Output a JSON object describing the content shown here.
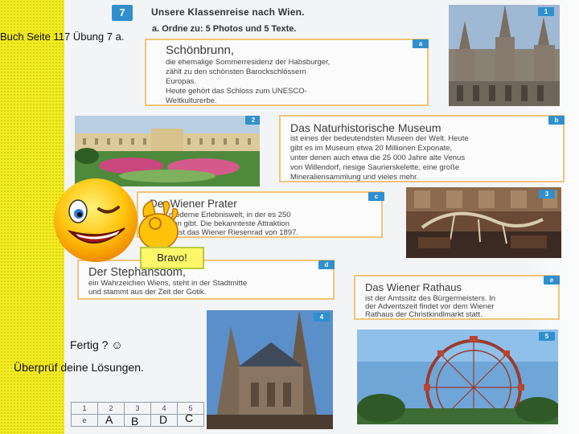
{
  "task_label": "Buch Seite 117 Übung 7 a.",
  "book": {
    "exercise_number": "7",
    "heading": "Unsere Klassenreise nach Wien.",
    "instruction": "a. Ordne zu: 5 Photos und 5 Texte."
  },
  "texts": [
    {
      "tag": "a",
      "title": "Schönbrunn,",
      "lines": [
        "die ehemalige Sommerresidenz der Habsburger,",
        "zählt zu den schönsten Barockschlössern",
        "Europas.",
        "Heute gehört das Schloss zum UNESCO-",
        "Weltkulturerbe."
      ]
    },
    {
      "tag": "b",
      "title": "Das Naturhistorische Museum",
      "lines": [
        "ist eines der bedeutendsten Museen der Welt. Heute",
        "gibt es im Museum etwa 20 Millionen Exponate,",
        "unter denen auch etwa die 25 000 Jahre alte Venus",
        "von Willendorf, riesige Saurierskelette, eine große",
        "Mineraliensammlung und vieles mehr."
      ]
    },
    {
      "tag": "c",
      "title": "Der Wiener Prater",
      "lines": [
        "moderne Erlebniswelt, in der es 250",
        "nen gibt. Die bekannteste Attraktion",
        "rs ist das Wiener Riesenrad von 1897."
      ]
    },
    {
      "tag": "d",
      "title": "Der Stephansdom,",
      "lines": [
        "ein Wahrzeichen Wiens, steht in der Stadtmitte",
        "und stammt aus der Zeit der Gotik."
      ]
    },
    {
      "tag": "e",
      "title": "Das Wiener Rathaus",
      "lines": [
        "ist der Amtssitz des Bürgermeisters. In",
        "der Adventszeit findet vor dem Wiener",
        "Rathaus der Christkindlmarkt statt."
      ]
    }
  ],
  "photos": [
    "1",
    "2",
    "3",
    "4",
    "5"
  ],
  "bravo": "Bravo!",
  "fertig": "Fertig ? ☺",
  "pruef": "Überprüf deine Lösungen.",
  "answer_table": {
    "numbers": [
      "1",
      "2",
      "3",
      "4",
      "5"
    ],
    "first_letter": "e",
    "answers": [
      "A",
      "B",
      "D",
      "C"
    ]
  },
  "colors": {
    "tag_blue": "#2f8fcf",
    "box_border": "#f2c477",
    "strip_yellow": "#f4ec22"
  }
}
